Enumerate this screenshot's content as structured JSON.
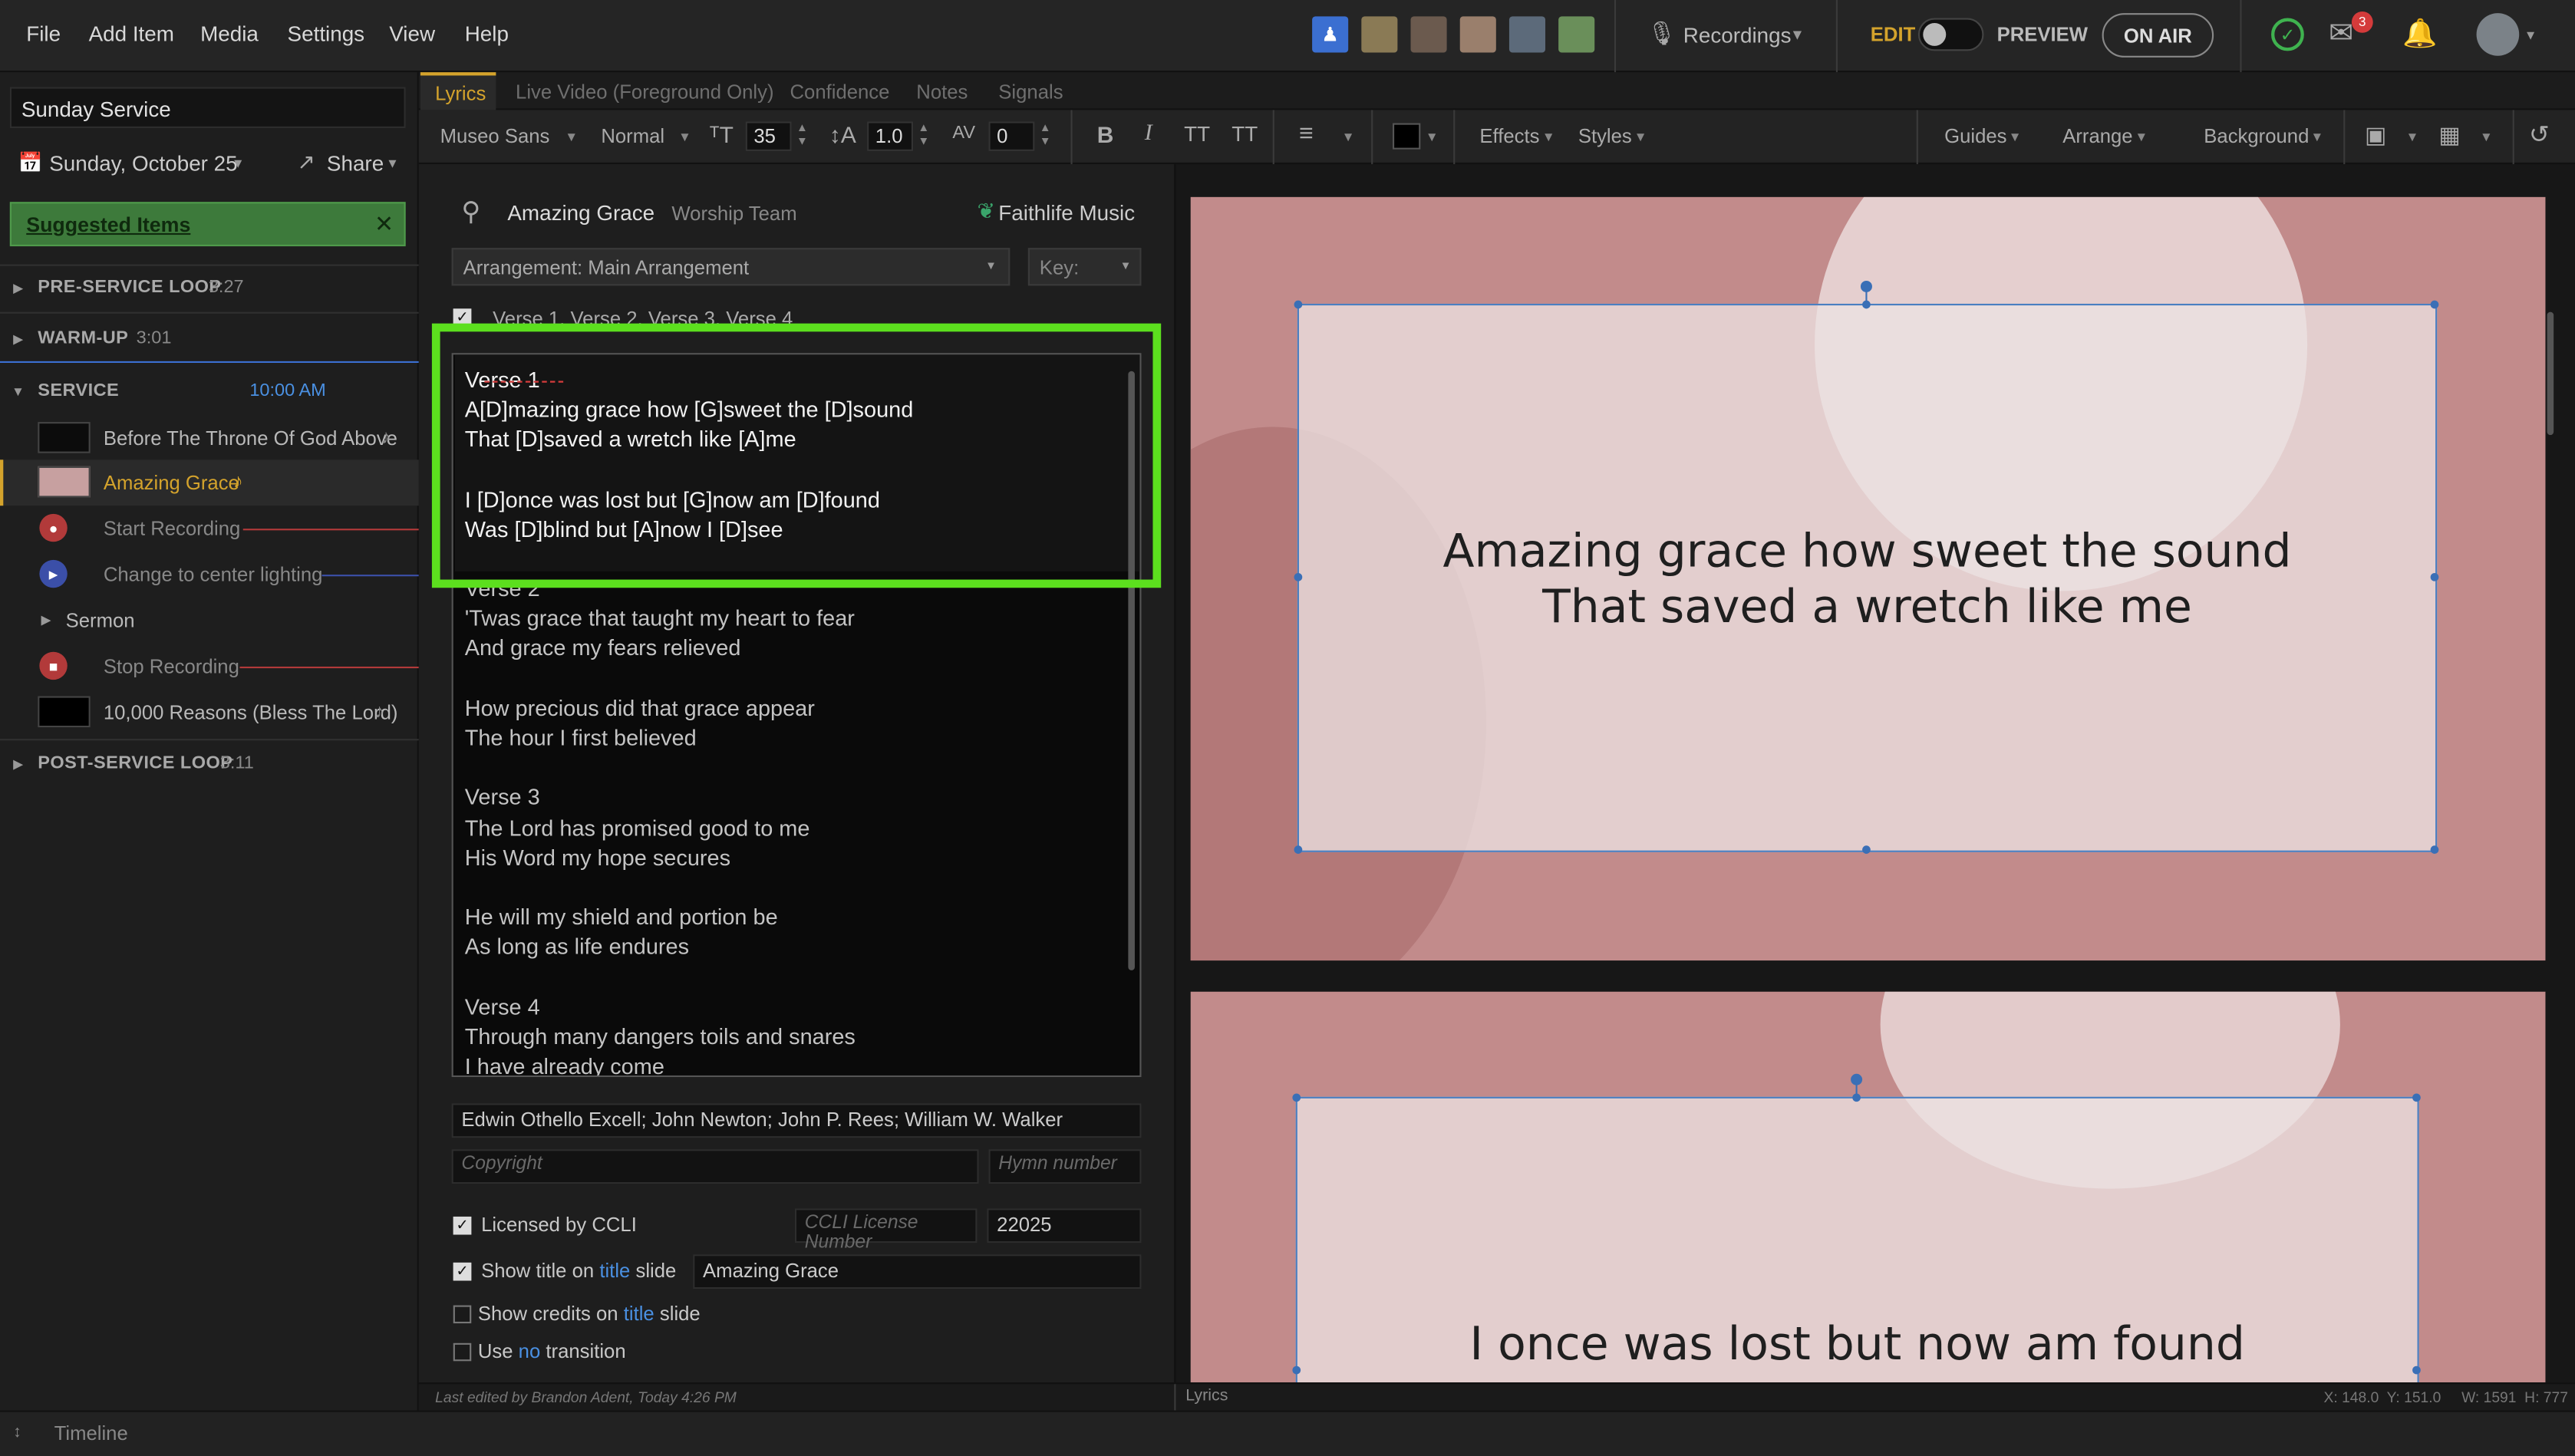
{
  "menu": [
    "File",
    "Add Item",
    "Media",
    "Settings",
    "View",
    "Help"
  ],
  "topbar": {
    "recordings": "Recordings",
    "edit": "EDIT",
    "preview": "PREVIEW",
    "on_air": "ON AIR",
    "chat_badge": "3"
  },
  "left": {
    "plan_title": "Sunday Service",
    "date": "Sunday, October 25",
    "share": "Share",
    "suggested": "Suggested Items",
    "sections": [
      {
        "label": "PRE-SERVICE LOOP",
        "time": "3:27"
      },
      {
        "label": "WARM-UP",
        "time": "3:01"
      },
      {
        "label": "SERVICE",
        "time": "10:00 AM"
      },
      {
        "label": "POST-SERVICE LOOP",
        "time": "3:11"
      }
    ],
    "items": [
      "Before The Throne Of God Above",
      "Amazing Grace",
      "Start Recording",
      "Change to center lighting",
      "Sermon",
      "Stop Recording",
      "10,000 Reasons (Bless The Lord)"
    ]
  },
  "tabs": [
    "Lyrics",
    "Live Video (Foreground Only)",
    "Confidence",
    "Notes",
    "Signals"
  ],
  "toolbar": {
    "font": "Museo Sans",
    "weight": "Normal",
    "size": "35",
    "line_height": "1.0",
    "tracking": "0",
    "effects": "Effects",
    "styles": "Styles",
    "guides": "Guides",
    "arrange": "Arrange",
    "background": "Background"
  },
  "editor": {
    "search_title": "Amazing Grace",
    "search_sub": "Worship Team",
    "brand": "Faithlife Music",
    "arrangement": "Arrangement: Main Arrangement",
    "key": "Key:",
    "sequence": "Verse 1, Verse 2, Verse 3, Verse 4",
    "lyrics_active": [
      "Verse 1",
      "A[D]mazing grace how [G]sweet the [D]sound",
      "That [D]saved a wretch like [A]me",
      "",
      "I [D]once was lost but [G]now am [D]found",
      "Was [D]blind but [A]now I [D]see"
    ],
    "lyrics_rest": [
      "Verse 2",
      "'Twas grace that taught my heart to fear",
      "And grace my fears relieved",
      "",
      "How precious did that grace appear",
      "The hour I first believed",
      "",
      "Verse 3",
      "The Lord has promised good to me",
      "His Word my hope secures",
      "",
      "He will my shield and portion be",
      "As long as life endures",
      "",
      "Verse 4",
      "Through many dangers toils and snares",
      "I have already come"
    ],
    "authors": "Edwin Othello Excell; John Newton; John P. Rees; William W. Walker",
    "copyright_ph": "Copyright",
    "hymn_ph": "Hymn number",
    "licensed": "Licensed by CCLI",
    "ccli_ph": "CCLI License Number",
    "ccli_value": "22025",
    "show_title_a": "Show title on",
    "show_title_link": "title",
    "show_title_b": "slide",
    "show_title_value": "Amazing Grace",
    "show_credits_a": "Show credits on",
    "show_credits_link": "title",
    "show_credits_b": "slide",
    "use_a": "Use",
    "use_link": "no",
    "use_b": "transition",
    "last_edited": "Last edited by Brandon Adent, Today 4:26 PM"
  },
  "preview": {
    "slide1": "Amazing grace how sweet the sound\nThat saved a wretch like me",
    "slide2": "I once was lost but now am found",
    "status_left": "Lyrics",
    "status_right": "X: 148.0  Y: 151.0     W: 1591  H: 777"
  },
  "timeline": "Timeline",
  "colors": {
    "accent_green": "#5cdf1e",
    "gold": "#d4a32c",
    "link": "#4a90e2",
    "slide_bg": "#c28b8b"
  }
}
